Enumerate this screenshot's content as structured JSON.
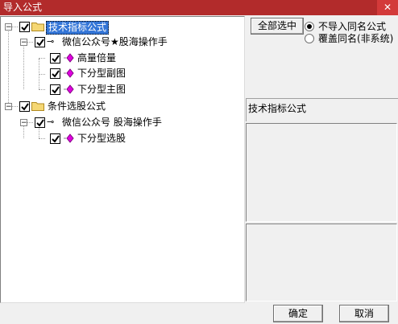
{
  "window": {
    "title": "导入公式",
    "close_glyph": "✕"
  },
  "tree": {
    "nodes": [
      {
        "label": "技术指标公式",
        "icon": "folder-icon",
        "checked": true,
        "expanded": true,
        "selected": true
      },
      {
        "label": "微信公众号★股海操作手",
        "icon": "key-icon",
        "checked": true,
        "expanded": true
      },
      {
        "label": "高量倍量",
        "icon": "diamond-icon",
        "checked": true
      },
      {
        "label": "下分型副图",
        "icon": "diamond-icon",
        "checked": true
      },
      {
        "label": "下分型主图",
        "icon": "diamond-icon",
        "checked": true
      },
      {
        "label": "条件选股公式",
        "icon": "folder-icon",
        "checked": true,
        "expanded": true
      },
      {
        "label": "微信公众号 股海操作手",
        "icon": "key-icon",
        "checked": true,
        "expanded": true
      },
      {
        "label": "下分型选股",
        "icon": "diamond-icon",
        "checked": true
      }
    ]
  },
  "options": {
    "select_all_label": "全部选中",
    "radio_no_import": "不导入同名公式",
    "radio_overwrite": "覆盖同名(非系统)",
    "selected_option": "不导入同名公式"
  },
  "right_pane": {
    "title": "技术指标公式"
  },
  "footer": {
    "ok_label": "确定",
    "cancel_label": "取消"
  },
  "colors": {
    "titlebar": "#b22b2b",
    "selection": "#3375d7",
    "diamond": "#e000e0",
    "folder": "#f5d774"
  }
}
